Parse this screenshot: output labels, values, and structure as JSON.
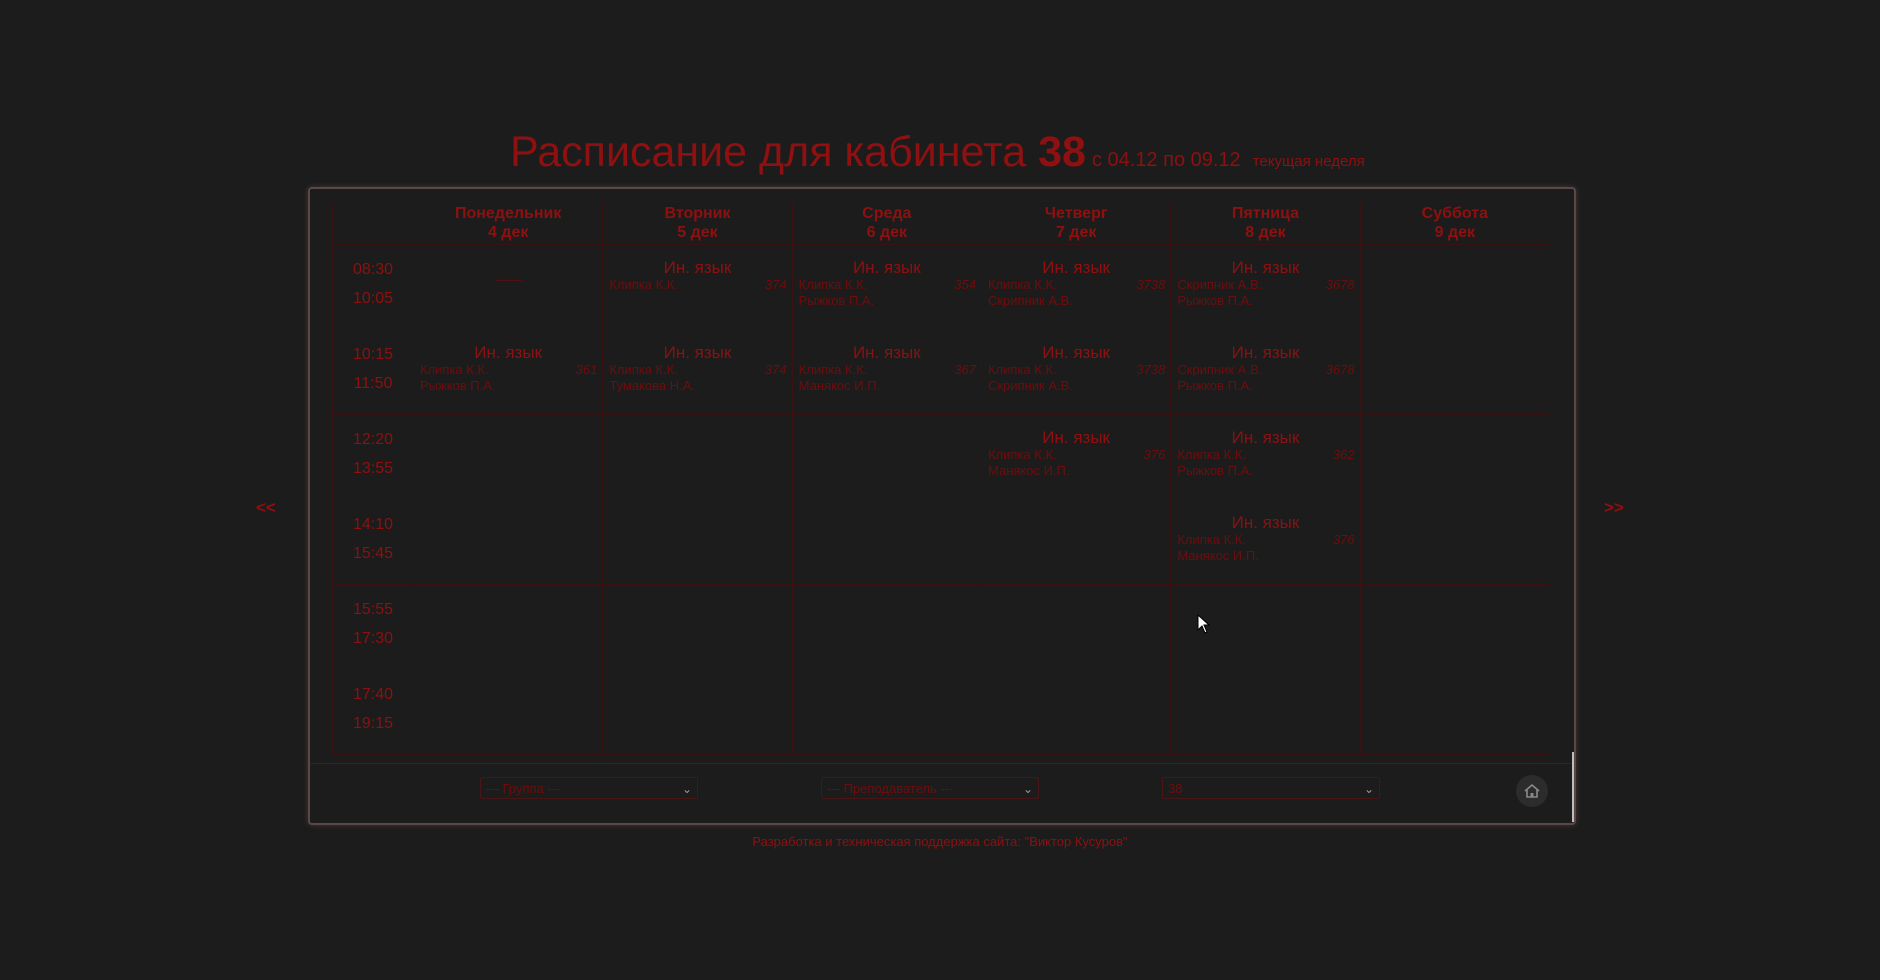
{
  "title": {
    "main": "Расписание для кабинета",
    "room": "38",
    "range": "с 04.12 по 09.12",
    "week": "текущая неделя"
  },
  "nav": {
    "prev": "<<",
    "next": ">>"
  },
  "days": [
    {
      "name": "Понедельник",
      "date": "4 дек"
    },
    {
      "name": "Вторник",
      "date": "5 дек"
    },
    {
      "name": "Среда",
      "date": "6 дек"
    },
    {
      "name": "Четверг",
      "date": "7 дек"
    },
    {
      "name": "Пятница",
      "date": "8 дек"
    },
    {
      "name": "Суббота",
      "date": "9 дек"
    }
  ],
  "times": [
    {
      "start": "08:30",
      "end": "10:05"
    },
    {
      "start": "10:15",
      "end": "11:50"
    },
    {
      "start": "12:20",
      "end": "13:55"
    },
    {
      "start": "14:10",
      "end": "15:45"
    },
    {
      "start": "15:55",
      "end": "17:30"
    },
    {
      "start": "17:40",
      "end": "19:15"
    }
  ],
  "time_separator": "-",
  "empty_marker": "——",
  "lessons": {
    "r0": {
      "tue": {
        "subject": "Ин. язык",
        "t1": "Клипка К.К.",
        "room": "374"
      },
      "wed": {
        "subject": "Ин. язык",
        "t1": "Клипка К.К.",
        "room": "354",
        "t2": "Рыжков П.А."
      },
      "thu": {
        "subject": "Ин. язык",
        "t1": "Клипка К.К.",
        "room": "3738",
        "t2": "Скрипник А.В."
      },
      "fri": {
        "subject": "Ин. язык",
        "t1": "Скрипник А.В.",
        "room": "3678",
        "t2": "Рыжков П.А."
      }
    },
    "r1": {
      "mon": {
        "subject": "Ин. язык",
        "t1": "Клипка К.К.",
        "room": "361",
        "t2": "Рыжков П.А."
      },
      "tue": {
        "subject": "Ин. язык",
        "t1": "Клипка К.К.",
        "room": "374",
        "t2": "Тумакова Н.А."
      },
      "wed": {
        "subject": "Ин. язык",
        "t1": "Клипка К.К.",
        "room": "367",
        "t2": "Манякос И.П."
      },
      "thu": {
        "subject": "Ин. язык",
        "t1": "Клипка К.К.",
        "room": "3738",
        "t2": "Скрипник А.В."
      },
      "fri": {
        "subject": "Ин. язык",
        "t1": "Скрипник А.В.",
        "room": "3678",
        "t2": "Рыжков П.А."
      }
    },
    "r2": {
      "thu": {
        "subject": "Ин. язык",
        "t1": "Клипка К.К.",
        "room": "376",
        "t2": "Манякос И.П."
      },
      "fri": {
        "subject": "Ин. язык",
        "t1": "Клипка К.К.",
        "room": "362",
        "t2": "Рыжков П.А."
      }
    },
    "r3": {
      "fri": {
        "subject": "Ин. язык",
        "t1": "Клипка К.К.",
        "room": "376",
        "t2": "Манякос И.П."
      }
    }
  },
  "filters": {
    "group": "--- Группа ---",
    "teacher": "--- Преподаватель ---",
    "room": "38"
  },
  "footer": "Разработка и техническая поддержка сайта: \"Виктор Кусуров\""
}
